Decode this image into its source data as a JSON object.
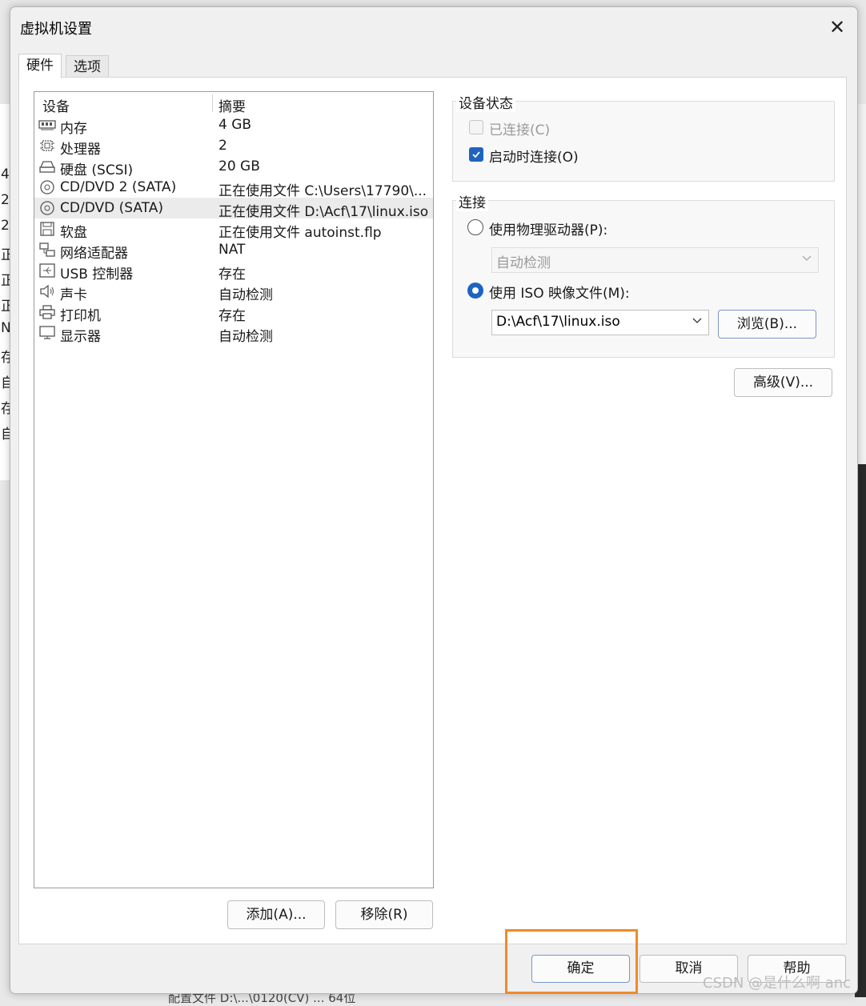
{
  "background": {
    "left_fragments": [
      "4",
      "2",
      "2",
      "正",
      "正",
      "正",
      "N",
      "存",
      "自",
      "存",
      "自"
    ],
    "bottom_text": "配置文件 D:\\...\\0120(CV)  ...  64位"
  },
  "dialog": {
    "title": "虚拟机设置",
    "close_label": "✕"
  },
  "tabs": [
    {
      "label": "硬件",
      "active": true
    },
    {
      "label": "选项",
      "active": false
    }
  ],
  "device_list": {
    "col_device": "设备",
    "col_summary": "摘要",
    "rows": [
      {
        "name": "内存",
        "summary": "4 GB",
        "icon": "memory-icon"
      },
      {
        "name": "处理器",
        "summary": "2",
        "icon": "cpu-icon"
      },
      {
        "name": "硬盘 (SCSI)",
        "summary": "20 GB",
        "icon": "harddisk-icon"
      },
      {
        "name": "CD/DVD 2 (SATA)",
        "summary": "正在使用文件 C:\\Users\\17790\\...",
        "icon": "cdrom-icon"
      },
      {
        "name": "CD/DVD (SATA)",
        "summary": "正在使用文件 D:\\Acf\\17\\linux.iso",
        "icon": "cdrom-icon",
        "selected": true
      },
      {
        "name": "软盘",
        "summary": "正在使用文件 autoinst.flp",
        "icon": "floppy-icon"
      },
      {
        "name": "网络适配器",
        "summary": "NAT",
        "icon": "network-icon"
      },
      {
        "name": "USB 控制器",
        "summary": "存在",
        "icon": "usb-icon"
      },
      {
        "name": "声卡",
        "summary": "自动检测",
        "icon": "speaker-icon"
      },
      {
        "name": "打印机",
        "summary": "存在",
        "icon": "printer-icon"
      },
      {
        "name": "显示器",
        "summary": "自动检测",
        "icon": "monitor-icon"
      }
    ]
  },
  "list_buttons": {
    "add": "添加(A)...",
    "remove": "移除(R)"
  },
  "device_status": {
    "title": "设备状态",
    "connected_label": "已连接(C)",
    "connected_checked": false,
    "connected_enabled": false,
    "connect_at_power_on_label": "启动时连接(O)",
    "connect_at_power_on_checked": true
  },
  "connection": {
    "title": "连接",
    "physical_label": "使用物理驱动器(P):",
    "physical_selected": false,
    "physical_value": "自动检测",
    "iso_label": "使用 ISO 映像文件(M):",
    "iso_selected": true,
    "iso_value": "D:\\Acf\\17\\linux.iso",
    "browse_label": "浏览(B)..."
  },
  "advanced_label": "高级(V)...",
  "footer": {
    "ok": "确定",
    "cancel": "取消",
    "help": "帮助"
  },
  "watermark": "CSDN @是什么啊 anc",
  "colors": {
    "accent": "#1f63c0",
    "highlight_box": "#f08a2c"
  }
}
